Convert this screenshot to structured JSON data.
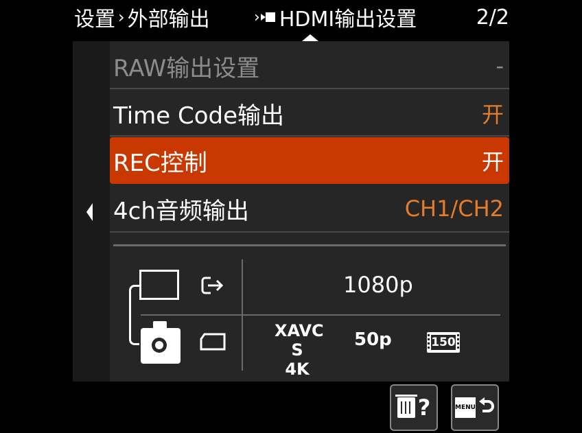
{
  "header": {
    "breadcrumb_1": "设置",
    "breadcrumb_sep": "›",
    "breadcrumb_2": "外部输出",
    "section_arrow": "›",
    "section_title": "HDMI输出设置",
    "page_indicator": "2/2"
  },
  "menu": {
    "items": [
      {
        "label": "RAW输出设置",
        "value": "-",
        "state": "disabled"
      },
      {
        "label": "Time Code输出",
        "value": "开",
        "state": "normal"
      },
      {
        "label": "REC控制",
        "value": "开",
        "state": "selected"
      },
      {
        "label": "4ch音频输出",
        "value": "CH1/CH2",
        "state": "normal"
      }
    ]
  },
  "info": {
    "hdmi_resolution": "1080p",
    "record_format": "XAVC S",
    "record_resolution": "4K",
    "frame_rate": "50p",
    "bitrate": "150"
  },
  "footer": {
    "help_symbol": "?",
    "menu_label": "MENU"
  },
  "colors": {
    "selected_bg": "#c83800",
    "value_orange": "#e47c2a",
    "panel_bg": "#262626"
  }
}
